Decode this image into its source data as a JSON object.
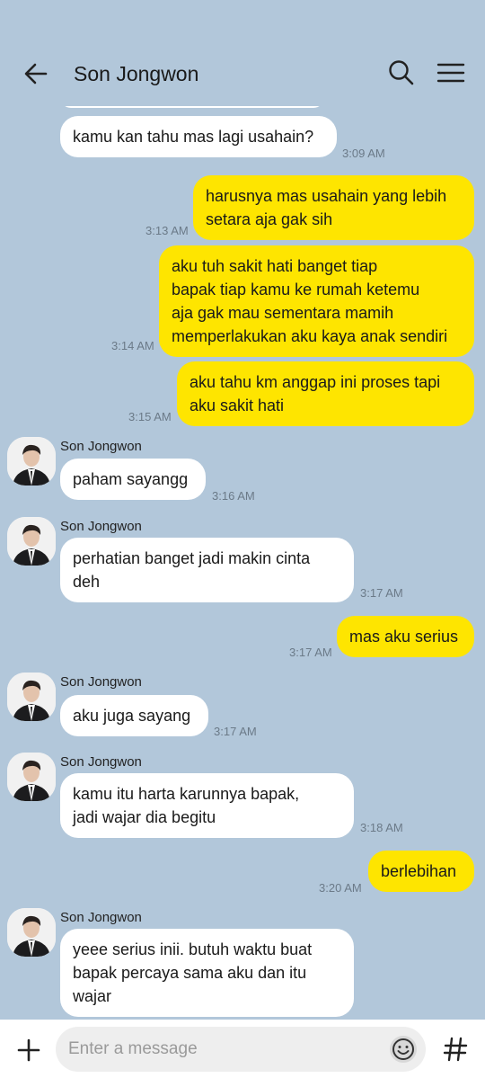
{
  "header": {
    "title": "Son Jongwon",
    "back_icon": "arrow-left-icon",
    "search_icon": "search-icon",
    "menu_icon": "menu-icon"
  },
  "messages": [
    {
      "dir": "in",
      "avatar": false,
      "text": "kamu kan tahu mas lagi usahain?",
      "time": "3:09 AM"
    },
    {
      "dir": "out",
      "text": "harusnya mas usahain yang lebih\nsetara aja gak sih",
      "time": "3:13 AM"
    },
    {
      "dir": "out",
      "text": "aku tuh sakit hati banget tiap\nbapak tiap kamu ke rumah ketemu\naja gak mau sementara mamih\nmemperlakukan aku kaya anak sendiri",
      "time": "3:14 AM"
    },
    {
      "dir": "out",
      "text": "aku tahu km anggap ini proses tapi\naku sakit hati",
      "time": "3:15 AM"
    },
    {
      "dir": "in",
      "avatar": true,
      "sender": "Son Jongwon",
      "text": "paham sayangg",
      "time": "3:16 AM"
    },
    {
      "dir": "in",
      "avatar": true,
      "sender": "Son Jongwon",
      "text": "perhatian banget jadi makin cinta\ndeh",
      "time": "3:17 AM"
    },
    {
      "dir": "out",
      "text": "mas aku serius",
      "time": "3:17 AM"
    },
    {
      "dir": "in",
      "avatar": true,
      "sender": "Son Jongwon",
      "text": "aku juga sayang",
      "time": "3:17 AM"
    },
    {
      "dir": "in",
      "avatar": true,
      "sender": "Son Jongwon",
      "text": "kamu itu harta karunnya bapak,\njadi wajar dia begitu",
      "time": "3:18 AM"
    },
    {
      "dir": "out",
      "text": "berlebihan",
      "time": "3:20 AM"
    },
    {
      "dir": "in",
      "avatar": true,
      "sender": "Son Jongwon",
      "text": "yeee serius inii. butuh waktu buat\nbapak percaya sama aku dan itu\nwajar",
      "time": ""
    }
  ],
  "input": {
    "placeholder": "Enter a message",
    "plus_icon": "plus-icon",
    "emoji_icon": "emoji-icon",
    "hash_icon": "hash-icon"
  },
  "colors": {
    "background": "#b2c7da",
    "outgoing_bubble": "#fee500",
    "incoming_bubble": "#ffffff"
  }
}
